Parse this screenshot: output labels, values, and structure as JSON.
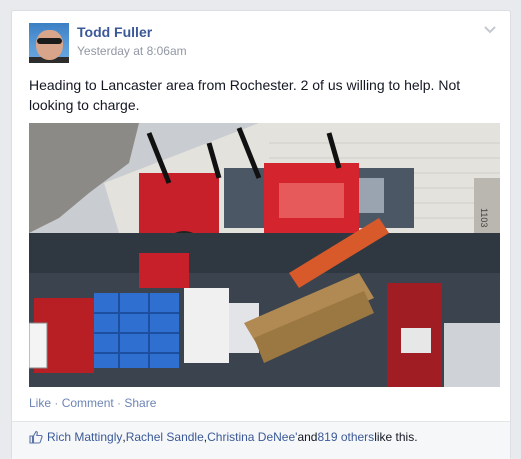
{
  "post": {
    "author": "Todd Fuller",
    "timestamp": "Yesterday at 8:06am",
    "text": "Heading to Lancaster area from Rochester. 2 of us willing to help. Not looking to charge.",
    "photo_label": "1103"
  },
  "actions": {
    "like": "Like",
    "comment": "Comment",
    "share": "Share",
    "separator": " · "
  },
  "likes": {
    "names": [
      "Rich Mattingly",
      "Rachel Sandle",
      "Christina DeNee'"
    ],
    "comma": ", ",
    "and": " and ",
    "others": "819 others",
    "suffix": " like this."
  },
  "colors": {
    "link": "#3b5998",
    "action_link": "#6d84b4",
    "muted": "#9197a3",
    "background": "#e9eaed"
  }
}
